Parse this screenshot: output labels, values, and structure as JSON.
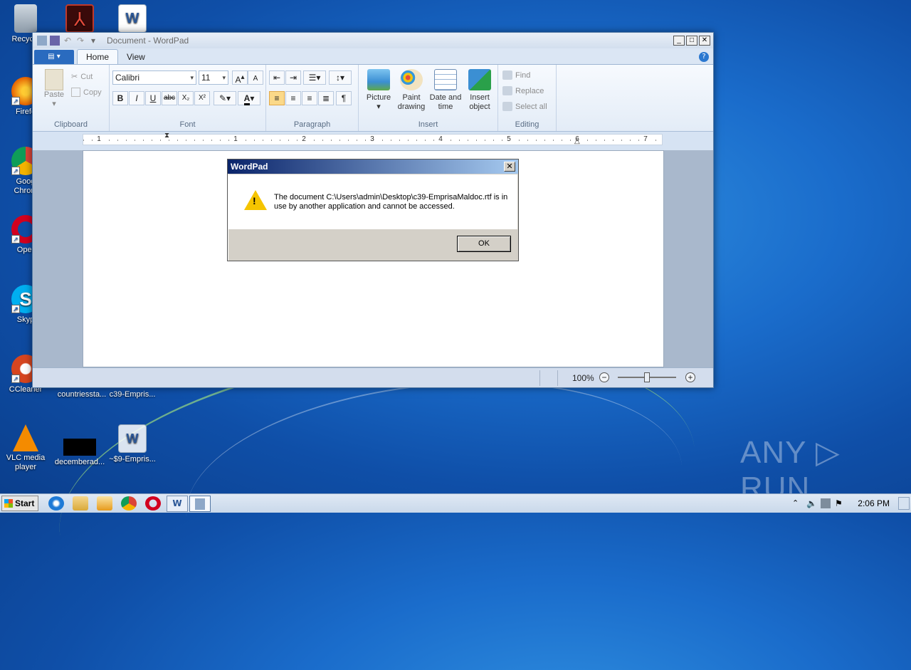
{
  "desktop": {
    "icons": [
      {
        "label": "Recycle",
        "icon": "recycle-bin-icon"
      },
      {
        "label": "Firefo",
        "icon": "firefox-icon"
      },
      {
        "label": "Goog\nChrom",
        "icon": "chrome-icon"
      },
      {
        "label": "Oper",
        "icon": "opera-icon"
      },
      {
        "label": "Skyp",
        "icon": "skype-icon"
      },
      {
        "label": "CCleaner",
        "icon": "ccleaner-icon"
      },
      {
        "label": "countriessta...",
        "icon": "file-icon"
      },
      {
        "label": "c39-Empris...",
        "icon": "word-doc-icon"
      },
      {
        "label": "VLC media player",
        "icon": "vlc-icon"
      },
      {
        "label": "decemberad...",
        "icon": "black-file-icon"
      },
      {
        "label": "~$9-Empris...",
        "icon": "word-doc-icon"
      }
    ]
  },
  "window": {
    "title": "Document - WordPad",
    "tabs": [
      "Home",
      "View"
    ],
    "ribbon": {
      "clipboard": {
        "label": "Clipboard",
        "paste": "Paste",
        "cut": "Cut",
        "copy": "Copy"
      },
      "font": {
        "label": "Font",
        "family": "Calibri",
        "size": "11",
        "buttons": [
          "B",
          "I",
          "U",
          "abc",
          "X₂",
          "X²"
        ]
      },
      "paragraph": {
        "label": "Paragraph"
      },
      "insert": {
        "label": "Insert",
        "picture": "Picture",
        "paint_1": "Paint",
        "paint_2": "drawing",
        "date_1": "Date and",
        "date_2": "time",
        "object_1": "Insert",
        "object_2": "object"
      },
      "editing": {
        "label": "Editing",
        "find": "Find",
        "replace": "Replace",
        "select_all": "Select all"
      }
    },
    "ruler_numbers": [
      "1",
      "1",
      "2",
      "3",
      "4",
      "5",
      "6",
      "7"
    ],
    "status": {
      "zoom": "100%",
      "zoom_level": 0.5
    }
  },
  "dialog": {
    "title": "WordPad",
    "message": "The document C:\\Users\\admin\\Desktop\\c39-EmprisaMaldoc.rtf is in use by another application and cannot be accessed.",
    "ok": "OK"
  },
  "taskbar": {
    "start": "Start",
    "clock": "2:06 PM"
  },
  "watermark": "ANY ▷ RUN"
}
